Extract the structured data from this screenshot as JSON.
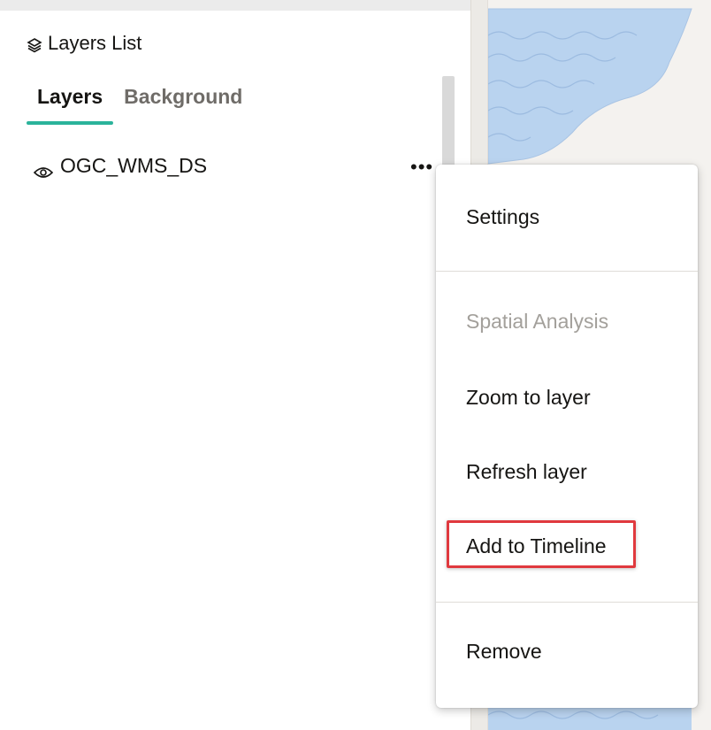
{
  "panel": {
    "title": "Layers List",
    "title_icon": "layers-icon",
    "tabs": [
      {
        "label": "Layers",
        "active": true
      },
      {
        "label": "Background",
        "active": false
      }
    ],
    "layers": [
      {
        "name": "OGC_WMS_DS",
        "icon": "eye-icon",
        "more_label": "•••"
      }
    ]
  },
  "context_menu": {
    "items": [
      {
        "label": "Settings",
        "enabled": true
      },
      {
        "label": "Spatial Analysis",
        "enabled": false
      },
      {
        "label": "Zoom to layer",
        "enabled": true
      },
      {
        "label": "Refresh layer",
        "enabled": true
      },
      {
        "label": "Add to Timeline",
        "enabled": true,
        "highlighted": true
      },
      {
        "label": "Remove",
        "enabled": true
      }
    ]
  },
  "colors": {
    "accent_tab": "#2bb39b",
    "highlight": "#e0393e",
    "map_water": "#b9d3ef",
    "map_land": "#f4f2ef"
  }
}
